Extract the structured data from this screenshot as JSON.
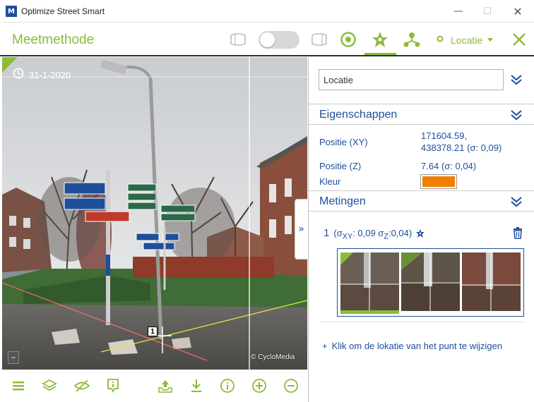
{
  "window": {
    "title": "Optimize Street Smart",
    "app_icon_glyph": "M",
    "controls": [
      "—",
      "☐",
      "✕"
    ]
  },
  "header": {
    "title": "Meetmethode",
    "location_dropdown_label": "Locatie",
    "accent_color": "#8cbc37",
    "icons": [
      "split-left-icon",
      "toggle-switch",
      "split-right-icon",
      "target-icon",
      "measure-star-icon",
      "nodes-icon",
      "location-dot-icon",
      "close-icon"
    ]
  },
  "viewer": {
    "date": "31-1-2020",
    "copyright": "© CycloMedia",
    "marker_label": "1",
    "minus_label": "–",
    "collapse_glyph": "»"
  },
  "bottom_toolbar": {
    "icons": [
      "menu-icon",
      "layers-icon",
      "hide-icon",
      "info-marker-icon",
      "upload-icon",
      "download-icon",
      "info-icon",
      "zoom-in-icon",
      "zoom-out-icon"
    ]
  },
  "panel": {
    "location_input_value": "Locatie",
    "eigenschappen": {
      "title": "Eigenschappen",
      "positie_xy_label": "Positie (XY)",
      "positie_xy_value_line1": "171604.59,",
      "positie_xy_value_line2": "438378.21 (σ: 0,09)",
      "positie_z_label": "Positie (Z)",
      "positie_z_value": "7.64 (σ: 0,04)",
      "kleur_label": "Kleur",
      "kleur_color": "#f07f00"
    },
    "metingen": {
      "title": "Metingen",
      "item_number": "1",
      "item_detail_prefix": "(σ",
      "sigma_xy_sub": "XY",
      "sigma_xy_value": ": 0,09 σ",
      "sigma_z_sub": "Z",
      "sigma_z_value": ":0,04)",
      "add_link": "Klik om de lokatie van het punt te wijzigen",
      "add_link_plus": "+"
    },
    "brand_blue": "#1f4e9c"
  }
}
